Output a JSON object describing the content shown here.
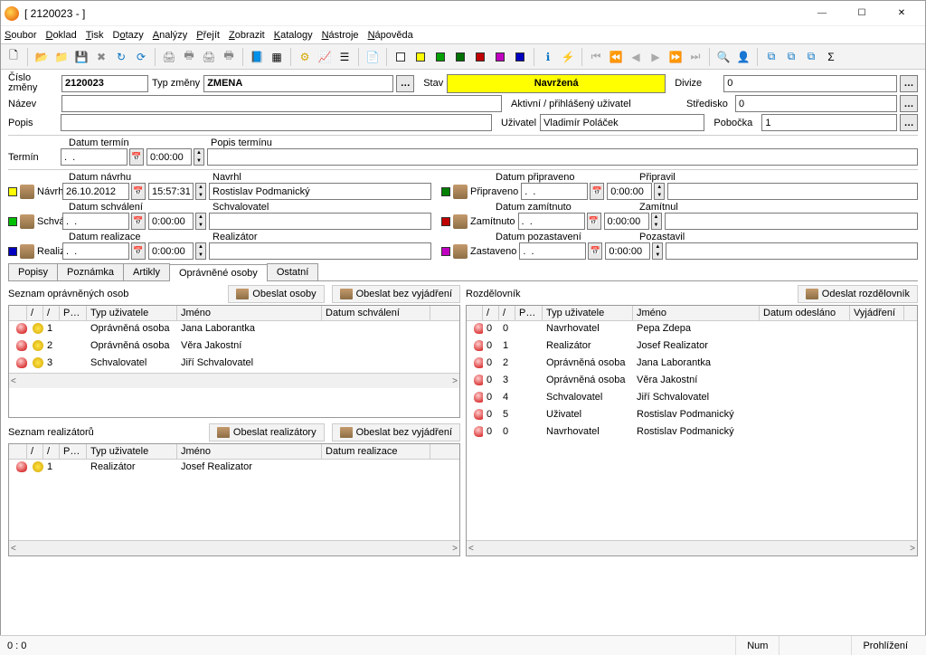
{
  "title": "[ 2120023 -  ]",
  "menu": [
    "Soubor",
    "Doklad",
    "Tisk",
    "Dotazy",
    "Analýzy",
    "Přejít",
    "Zobrazit",
    "Katalogy",
    "Nástroje",
    "Nápověda"
  ],
  "header": {
    "cislo_zmeny_lbl": "Číslo\nzměny",
    "cislo_zmeny": "2120023",
    "typ_zmeny_lbl": "Typ změny",
    "typ_zmeny": "ZMENA",
    "stav_lbl": "Stav",
    "stav": "Navržená",
    "divize_lbl": "Divize",
    "divize": "0",
    "nazev_lbl": "Název",
    "nazev": "",
    "akt_lbl": "Aktivní / přihlášený uživatel",
    "stredisko_lbl": "Středisko",
    "stredisko": "0",
    "popis_lbl": "Popis",
    "popis": "",
    "uzivatel_lbl": "Uživatel",
    "uzivatel": "Vladimír Poláček",
    "pobocka_lbl": "Pobočka",
    "pobocka": "1"
  },
  "termin": {
    "lbl": "Termín",
    "datum_lbl": "Datum termín",
    "datum": ".  .",
    "cas": "0:00:00",
    "popis_lbl": "Popis termínu",
    "popis": ""
  },
  "sections": [
    {
      "name": "Návrh",
      "sq": "#ffff00",
      "d_lbl": "Datum návrhu",
      "d": "26.10.2012",
      "t": "15:57:31",
      "u_lbl": "Navrhl",
      "u": "Rostislav Podmanický",
      "r_name": "Připraveno",
      "r_sq": "#008000",
      "rd_lbl": "Datum připraveno",
      "rd": ".  .",
      "rt": "0:00:00",
      "ru_lbl": "Připravil",
      "ru": ""
    },
    {
      "name": "Schválení",
      "sq": "#00c000",
      "d_lbl": "Datum schválení",
      "d": ".  .",
      "t": "0:00:00",
      "u_lbl": "Schvalovatel",
      "u": "",
      "r_name": "Zamítnuto",
      "r_sq": "#c00000",
      "rd_lbl": "Datum zamítnuto",
      "rd": ".  .",
      "rt": "0:00:00",
      "ru_lbl": "Zamítnul",
      "ru": ""
    },
    {
      "name": "Realizace",
      "sq": "#0000c0",
      "d_lbl": "Datum realizace",
      "d": ".  .",
      "t": "0:00:00",
      "u_lbl": "Realizátor",
      "u": "",
      "r_name": "Zastaveno",
      "r_sq": "#c000c0",
      "rd_lbl": "Datum pozastavení",
      "rd": ".  .",
      "rt": "0:00:00",
      "ru_lbl": "Pozastavil",
      "ru": ""
    }
  ],
  "tabs": [
    "Popisy",
    "Poznámka",
    "Artikly",
    "Oprávněné osoby",
    "Ostatní"
  ],
  "active_tab": 3,
  "left_panel": {
    "seznam_lbl": "Seznam oprávněných osob",
    "btn1": "Obeslat osoby",
    "btn2": "Obeslat bez vyjádření",
    "cols": [
      "",
      "/",
      "/",
      "P…",
      "Typ uživatele",
      "Jméno",
      "Datum schválení"
    ],
    "rows": [
      {
        "p": "1",
        "typ": "Oprávněná osoba",
        "jm": "Jana Laborantka"
      },
      {
        "p": "2",
        "typ": "Oprávněná osoba",
        "jm": "Věra Jakostní"
      },
      {
        "p": "3",
        "typ": "Schvalovatel",
        "jm": "Jiří Schvalovatel"
      }
    ],
    "seznam2_lbl": "Seznam realizátorů",
    "btn3": "Obeslat realizátory",
    "btn4": "Obeslat bez vyjádření",
    "cols2": [
      "",
      "/",
      "/",
      "P…",
      "Typ uživatele",
      "Jméno",
      "Datum realizace"
    ],
    "rows2": [
      {
        "p": "1",
        "typ": "Realizátor",
        "jm": "Josef Realizator"
      }
    ]
  },
  "right_panel": {
    "lbl": "Rozdělovník",
    "btn": "Odeslat rozdělovník",
    "cols": [
      "",
      "/",
      "/",
      "P…",
      "Typ uživatele",
      "Jméno",
      "Datum odesláno",
      "Vyjádření"
    ],
    "rows": [
      {
        "a": "0",
        "b": "0",
        "typ": "Navrhovatel",
        "jm": "Pepa Zdepa"
      },
      {
        "a": "0",
        "b": "1",
        "typ": "Realizátor",
        "jm": "Josef Realizator"
      },
      {
        "a": "0",
        "b": "2",
        "typ": "Oprávněná osoba",
        "jm": "Jana Laborantka"
      },
      {
        "a": "0",
        "b": "3",
        "typ": "Oprávněná osoba",
        "jm": "Věra Jakostní"
      },
      {
        "a": "0",
        "b": "4",
        "typ": "Schvalovatel",
        "jm": "Jiří Schvalovatel"
      },
      {
        "a": "0",
        "b": "5",
        "typ": "Uživatel",
        "jm": "Rostislav Podmanický"
      },
      {
        "a": "0",
        "b": "0",
        "typ": "Navrhovatel",
        "jm": "Rostislav Podmanický"
      }
    ]
  },
  "statusbar": {
    "left": "0 :   0",
    "num": "Num",
    "right": "Prohlížení"
  }
}
